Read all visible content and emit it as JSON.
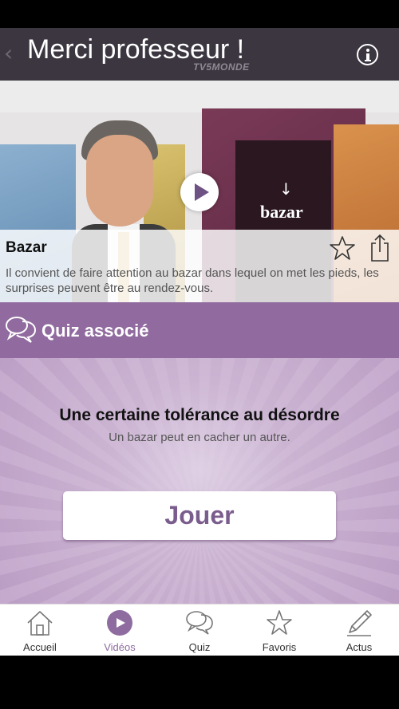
{
  "header": {
    "back_glyph": "‹",
    "title": "Merci professeur !",
    "brand": "TV5MONDE",
    "info_icon": "info-icon"
  },
  "video": {
    "caption": "bazar",
    "arrow": "↓",
    "title": "Bazar",
    "description": "Il convient de faire attention au bazar dans lequel on met les pieds, les surprises peuvent être au rendez-vous.",
    "favorite_icon": "star-outline-icon",
    "share_icon": "share-icon"
  },
  "quiz": {
    "section_label": "Quiz associé",
    "title": "Une certaine tolérance au désordre",
    "subtitle": "Un bazar peut en cacher un autre.",
    "play_label": "Jouer"
  },
  "tabs": [
    {
      "label": "Accueil",
      "icon": "home-icon",
      "active": false
    },
    {
      "label": "Vidéos",
      "icon": "play-icon",
      "active": true
    },
    {
      "label": "Quiz",
      "icon": "speech-bubbles-icon",
      "active": false
    },
    {
      "label": "Favoris",
      "icon": "star-icon",
      "active": false
    },
    {
      "label": "Actus",
      "icon": "pencil-icon",
      "active": false
    }
  ],
  "colors": {
    "header_bg": "#3b3640",
    "accent": "#916b9f",
    "button_text": "#7a5d8d",
    "active_tab": "#8e6ca0"
  }
}
